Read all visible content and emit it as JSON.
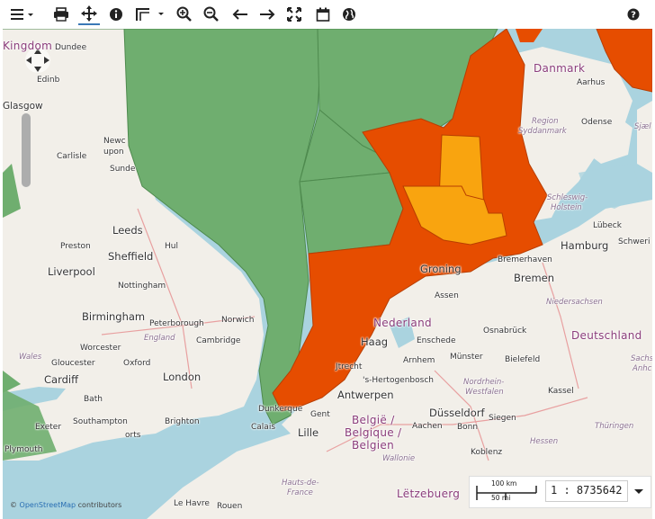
{
  "toolbar": {
    "menu_icon": "hamburger-menu-icon",
    "print_icon": "print-icon",
    "pan_icon": "pan-move-icon",
    "info_icon": "info-icon",
    "measure_icon": "measure-icon",
    "zoom_in_icon": "zoom-in-icon",
    "zoom_out_icon": "zoom-out-icon",
    "back_icon": "arrow-left-icon",
    "forward_icon": "arrow-right-icon",
    "fullextent_icon": "fullscreen-icon",
    "calendar_icon": "calendar-icon",
    "globe_icon": "globe-icon",
    "help_icon": "help-icon",
    "active_tool_color": "#3a79b7"
  },
  "colors": {
    "land": "#f2efe9",
    "sea": "#aad3df",
    "green_zone": "#6fae6f",
    "orange_zone": "#e64d00",
    "yellow_zone": "#f9a40f"
  },
  "labels": {
    "kingdom": "Kingdom",
    "dundee": "Dundee",
    "edinburgh": "Edinb",
    "glasgow": "Glasgow",
    "newcastle1": "Newc",
    "newcastle2": "upon",
    "carlisle": "Carlisle",
    "sunderland": "Sunde",
    "leeds": "Leeds",
    "preston": "Preston",
    "hull": "Hul",
    "sheffield": "Sheffield",
    "liverpool": "Liverpool",
    "nottingham": "Nottingham",
    "birmingham": "Birmingham",
    "peterborough": "Peterborough",
    "norwich": "Norwich",
    "england": "England",
    "cambridge": "Cambridge",
    "worcester": "Worcester",
    "wales": "Wales",
    "gloucester": "Gloucester",
    "oxford": "Oxford",
    "cardiff": "Cardiff",
    "london": "London",
    "bath": "Bath",
    "exeter": "Exeter",
    "southampton": "Southampton",
    "brighton": "Brighton",
    "portsmouth": "orts",
    "plymouth": "Plymouth",
    "dunkerque": "Dunkerque",
    "calais": "Calais",
    "lille": "Lille",
    "le_havre": "Le Havre",
    "rouen": "Rouen",
    "hauts_de_france1": "Hauts-de-",
    "hauts_de_france2": "France",
    "gent": "Gent",
    "antwerpen": "Antwerpen",
    "belgie1": "België /",
    "belgie2": "Belgique /",
    "belgie3": "Belgien",
    "wallonie": "Wallonie",
    "letzebuerg": "Lëtzebuerg",
    "nederland": "Nederland",
    "den_haag": "Haag",
    "utrecht": "Jtrecht",
    "den_bosch": "'s-Hertogenbosch",
    "arnhem": "Arnhem",
    "enschede": "Enschede",
    "groningen": "Groning",
    "assen": "Assen",
    "dusseldorf": "Düsseldorf",
    "aachen": "Aachen",
    "bonn": "Bonn",
    "koblenz": "Koblenz",
    "siegen": "Siegen",
    "kassel": "Kassel",
    "hessen": "Hessen",
    "thuringen": "Thüringen",
    "nrw1": "Nordrhein-",
    "nrw2": "Westfalen",
    "munster": "Münster",
    "bielefeld": "Bielefeld",
    "osnabruck": "Osnabrück",
    "bremen": "Bremen",
    "bremerhaven": "Bremerhaven",
    "niedersachsen": "Niedersachsen",
    "deutschland": "Deutschland",
    "sachsen1": "Sachs",
    "sachsen2": "Anhc",
    "hamburg": "Hamburg",
    "lubeck": "Lübeck",
    "schwerin": "Schweri",
    "schleswig1": "Schleswig-",
    "schleswig2": "Holstein",
    "danmark": "Danmark",
    "aarhus": "Aarhus",
    "odense": "Odense",
    "region1": "Region",
    "region2": "Syddanmark",
    "sjaelland": "Sjæl"
  },
  "attribution": {
    "prefix": "© ",
    "osm": "OpenStreetMap",
    "suffix": " contributors"
  },
  "scale": {
    "km_label": "100 km",
    "mi_label": "50 mi",
    "ratio": "1 : 8735642",
    "dropdown_icon": "caret-down-icon"
  }
}
